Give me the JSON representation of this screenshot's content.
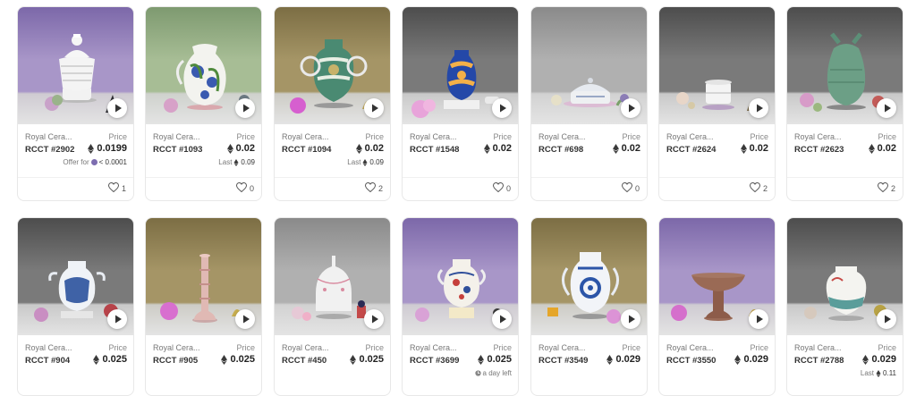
{
  "common": {
    "price_label": "Price",
    "last_prefix": "Last",
    "offer_prefix": "Offer for"
  },
  "colors": {
    "purple": "#8a76b4",
    "green": "#8fa67d",
    "olive": "#8d8158",
    "dark": "#5a5a5a",
    "light": "#9b9b9b"
  },
  "cards": [
    {
      "collection": "Royal Cera...",
      "token": "RCCT #2902",
      "price": "0.0199",
      "sub_type": "offer",
      "sub_value": "< 0.0001",
      "likes": "1",
      "bg": "purple",
      "vase": "lidded-white-pot",
      "icon": "play-icon"
    },
    {
      "collection": "Royal Cera...",
      "token": "RCCT #1093",
      "price": "0.02",
      "sub_type": "last",
      "sub_value": "0.09",
      "likes": "0",
      "bg": "green",
      "vase": "blue-floral-vase",
      "icon": "play-icon"
    },
    {
      "collection": "Royal Cera...",
      "token": "RCCT #1094",
      "price": "0.02",
      "sub_type": "last",
      "sub_value": "0.09",
      "likes": "2",
      "bg": "olive",
      "vase": "green-two-handle-vase",
      "icon": "play-icon"
    },
    {
      "collection": "Royal Cera...",
      "token": "RCCT #1548",
      "price": "0.02",
      "sub_type": "none",
      "sub_value": "",
      "likes": "0",
      "bg": "dark",
      "vase": "blue-orange-vase",
      "icon": "play-icon"
    },
    {
      "collection": "Royal Cera...",
      "token": "RCCT #698",
      "price": "0.02",
      "sub_type": "none",
      "sub_value": "",
      "likes": "0",
      "bg": "light",
      "vase": "lidded-dish",
      "icon": "play-icon"
    },
    {
      "collection": "Royal Cera...",
      "token": "RCCT #2624",
      "price": "0.02",
      "sub_type": "none",
      "sub_value": "",
      "likes": "2",
      "bg": "dark",
      "vase": "white-bowl",
      "icon": "play-icon"
    },
    {
      "collection": "Royal Cera...",
      "token": "RCCT #2623",
      "price": "0.02",
      "sub_type": "none",
      "sub_value": "",
      "likes": "2",
      "bg": "dark",
      "vase": "celadon-ewer",
      "icon": "play-icon"
    },
    {
      "collection": "Royal Cera...",
      "token": "RCCT #904",
      "price": "0.025",
      "sub_type": "none",
      "sub_value": "",
      "likes": "",
      "bg": "dark",
      "vase": "blue-white-vase",
      "icon": "play-icon"
    },
    {
      "collection": "Royal Cera...",
      "token": "RCCT #905",
      "price": "0.025",
      "sub_type": "none",
      "sub_value": "",
      "likes": "",
      "bg": "olive",
      "vase": "tall-candlestick",
      "icon": "play-icon"
    },
    {
      "collection": "Royal Cera...",
      "token": "RCCT #450",
      "price": "0.025",
      "sub_type": "none",
      "sub_value": "",
      "likes": "",
      "bg": "light",
      "vase": "white-jar",
      "icon": "play-icon"
    },
    {
      "collection": "Royal Cera...",
      "token": "RCCT #3699",
      "price": "0.025",
      "sub_type": "time",
      "sub_value": "a day left",
      "likes": "",
      "bg": "purple",
      "vase": "painted-amphora",
      "icon": "play-icon"
    },
    {
      "collection": "Royal Cera...",
      "token": "RCCT #3549",
      "price": "0.029",
      "sub_type": "none",
      "sub_value": "",
      "likes": "",
      "bg": "olive",
      "vase": "blue-pattern-jar",
      "icon": "play-icon"
    },
    {
      "collection": "Royal Cera...",
      "token": "RCCT #3550",
      "price": "0.029",
      "sub_type": "none",
      "sub_value": "",
      "likes": "",
      "bg": "purple",
      "vase": "brown-compote",
      "icon": "play-icon"
    },
    {
      "collection": "Royal Cera...",
      "token": "RCCT #2788",
      "price": "0.029",
      "sub_type": "last",
      "sub_value": "0.11",
      "likes": "",
      "bg": "dark",
      "vase": "white-jar-blue-band",
      "icon": "play-icon"
    }
  ]
}
